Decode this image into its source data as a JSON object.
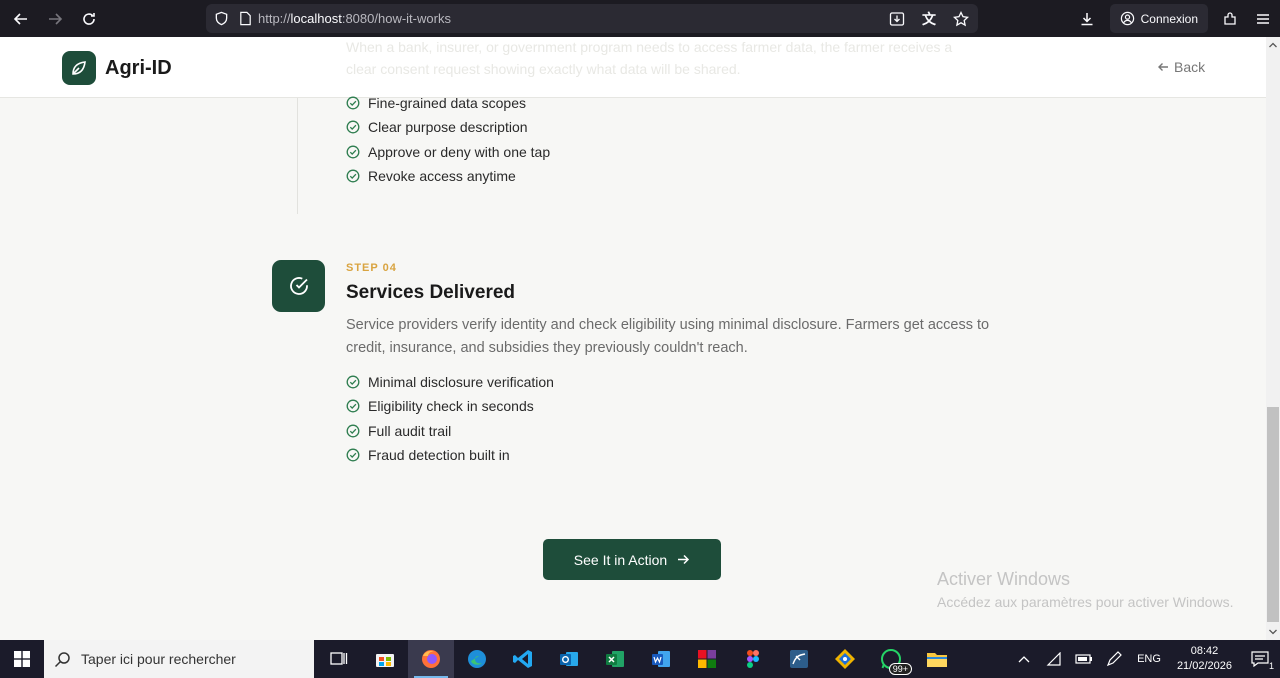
{
  "browser": {
    "url_prefix": "http://",
    "url_host": "localhost",
    "url_rest": ":8080/how-it-works",
    "account_label": "Connexion"
  },
  "header": {
    "brand": "Agri-ID",
    "back_label": "Back",
    "ghost_line_1": "When a bank, insurer, or government program needs to access farmer data, the farmer receives a",
    "ghost_line_2": "clear consent request showing exactly what data will be shared."
  },
  "step3": {
    "features": [
      "Fine-grained data scopes",
      "Clear purpose description",
      "Approve or deny with one tap",
      "Revoke access anytime"
    ]
  },
  "step4": {
    "label": "STEP 04",
    "title": "Services Delivered",
    "description": "Service providers verify identity and check eligibility using minimal disclosure. Farmers get access to credit, insurance, and subsidies they previously couldn't reach.",
    "features": [
      "Minimal disclosure verification",
      "Eligibility check in seconds",
      "Full audit trail",
      "Fraud detection built in"
    ]
  },
  "cta": {
    "label": "See It in Action"
  },
  "watermark": {
    "title": "Activer Windows",
    "subtitle": "Accédez aux paramètres pour activer Windows."
  },
  "taskbar": {
    "search_placeholder": "Taper ici pour rechercher",
    "whatsapp_badge": "99+",
    "language": "ENG",
    "time": "08:42",
    "date": "21/02/2026",
    "notification_count": "1"
  },
  "colors": {
    "brand_green": "#1e4d3a",
    "step_accent": "#d9a441",
    "check_green": "#2e7d4f"
  }
}
